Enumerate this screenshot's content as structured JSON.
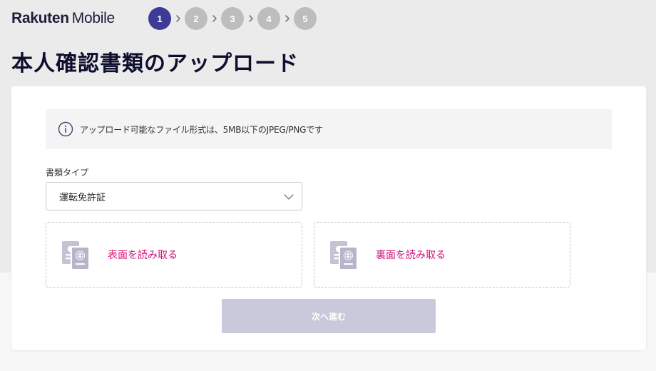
{
  "header": {
    "logo_brand": "Rakuten",
    "logo_product": "Mobile"
  },
  "steps": {
    "items": [
      "1",
      "2",
      "3",
      "4",
      "5"
    ],
    "current": 1,
    "active_color": "#3f3a96",
    "inactive_color": "#bdbdbd"
  },
  "page": {
    "title": "本人確認書類のアップロード"
  },
  "info": {
    "icon": "info-circle-icon",
    "text": "アップロード可能なファイル形式は、5MB以下のJPEG/PNGです"
  },
  "document_type": {
    "label": "書類タイプ",
    "selected": "運転免許証",
    "icon": "chevron-down-icon"
  },
  "upload": {
    "front_label": "表面を読み取る",
    "back_label": "裏面を読み取る",
    "icon": "id-document-icon",
    "label_color": "#d0137a"
  },
  "actions": {
    "next_label": "次へ進む",
    "next_disabled": true
  }
}
